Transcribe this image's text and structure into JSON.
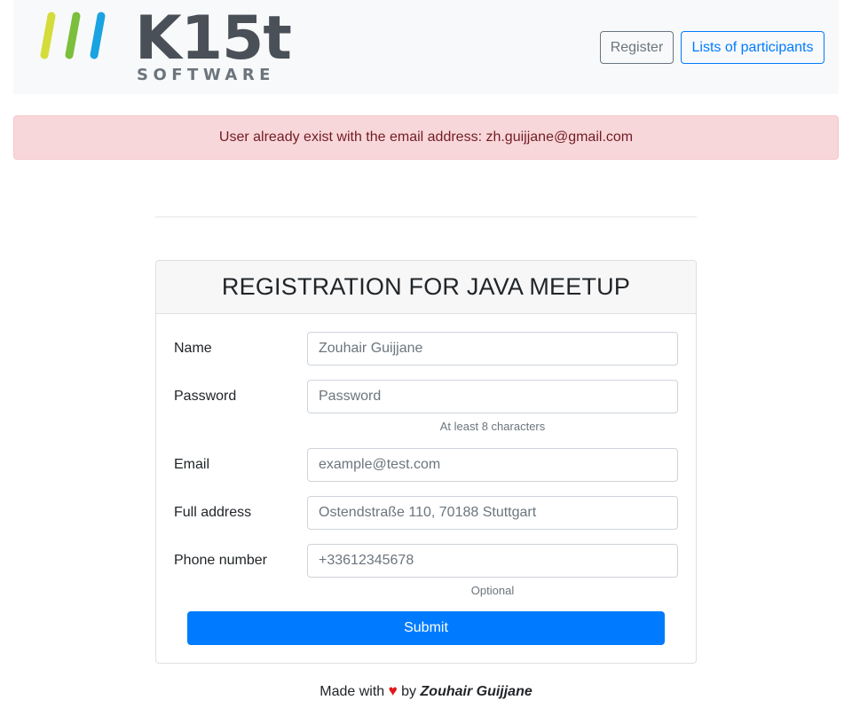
{
  "header": {
    "logo": {
      "brand": "K15t",
      "sub": "SOFTWARE",
      "stripe_colors": [
        "#d4dc3a",
        "#7bbf3c",
        "#1aa3e1"
      ]
    },
    "register_label": "Register",
    "participants_label": "Lists of participants"
  },
  "alert": {
    "message": "User already exist with the email address: zh.guijjane@gmail.com"
  },
  "form": {
    "title": "REGISTRATION FOR JAVA MEETUP",
    "fields": [
      {
        "label": "Name",
        "placeholder": "Zouhair Guijjane",
        "help": ""
      },
      {
        "label": "Password",
        "placeholder": "Password",
        "help": "At least 8 characters"
      },
      {
        "label": "Email",
        "placeholder": "example@test.com",
        "help": ""
      },
      {
        "label": "Full address",
        "placeholder": "Ostendstraße 110, 70188 Stuttgart",
        "help": ""
      },
      {
        "label": "Phone number",
        "placeholder": "+33612345678",
        "help": "Optional"
      }
    ],
    "submit_label": "Submit"
  },
  "footer": {
    "made_with": "Made with",
    "heart": "♥",
    "by": "by",
    "author": "Zouhair Guijjane"
  },
  "colors": {
    "primary": "#007bff",
    "secondary": "#6c757d",
    "alert_bg": "#f8d7da",
    "alert_text": "#721c24",
    "heart": "#e0181b"
  }
}
